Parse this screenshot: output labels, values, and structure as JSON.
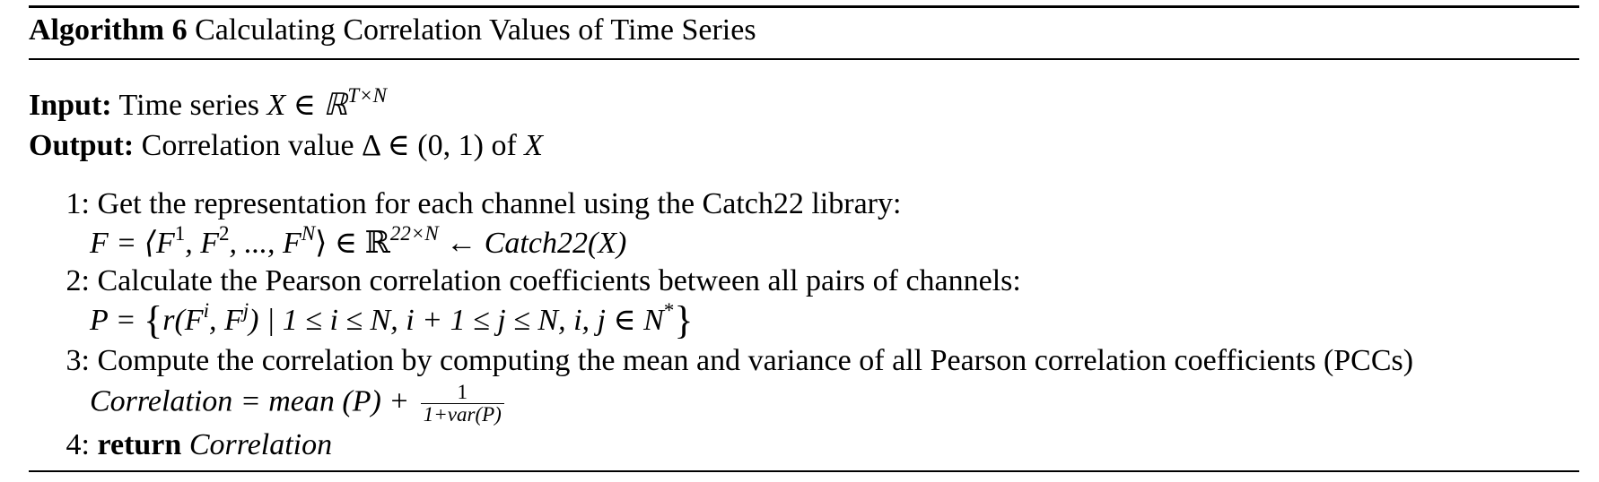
{
  "algorithm": {
    "label": "Algorithm 6",
    "title": "Calculating Correlation Values of Time Series",
    "input_label": "Input:",
    "input_text": "Time series ",
    "input_math": "X ∈ ℝ",
    "input_sup": "T×N",
    "output_label": "Output:",
    "output_text": "Correlation value ",
    "output_math": "Δ  ∈ (0, 1)",
    "output_tail": " of ",
    "output_var": "X",
    "steps": [
      {
        "num": "1:",
        "text": "Get the representation for each channel using the Catch22 library:"
      },
      {
        "num": "2:",
        "text": "Calculate the Pearson correlation coefficients between all pairs of channels:"
      },
      {
        "num": "3:",
        "text": "Compute the correlation by computing the mean and variance of all Pearson correlation coefficients (PCCs)"
      },
      {
        "num": "4:",
        "keyword": "return",
        "var": "Correlation"
      }
    ],
    "eq1": {
      "a": "F = ⟨F",
      "s1": "1",
      "b": ", F",
      "s2": "2",
      "c": ", ..., F",
      "s3": "N",
      "d": "⟩ ∈ ℝ",
      "s4": "22×N",
      "e": " ← Catch22(X)"
    },
    "eq2": {
      "a": "P = ",
      "lb": "{",
      "b": "r(F",
      "s1": "i",
      "c": ", F",
      "s2": "j",
      "d": ") | 1 ≤ i ≤ N, i + 1 ≤ j ≤ N, i, j ∈ N",
      "s3": "*",
      "rb": "}"
    },
    "eq3": {
      "a": "Correlation = mean (P) + ",
      "num": "1",
      "den": "1+var(P)"
    }
  }
}
